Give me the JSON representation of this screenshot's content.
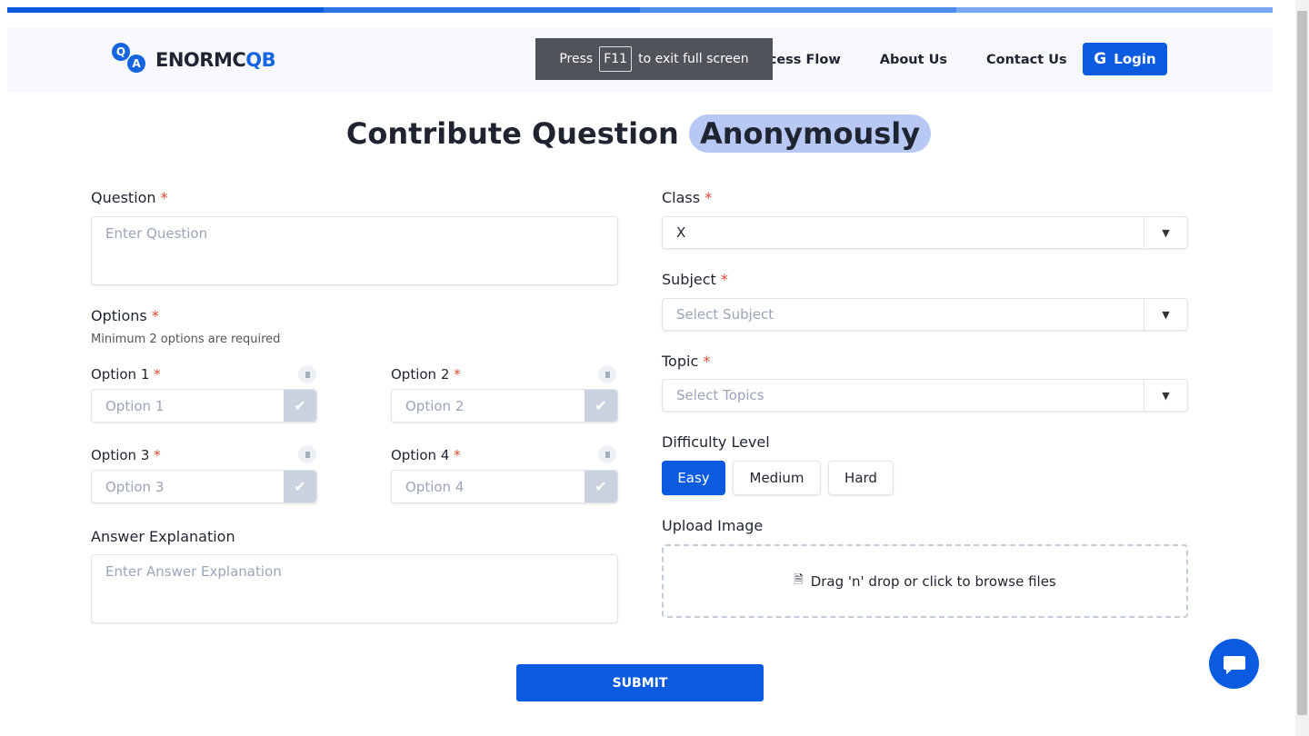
{
  "progress_colors": [
    "#0a5be0",
    "#2c74e8",
    "#4a8cef",
    "#7aa9f3"
  ],
  "brand": {
    "prefix": "ENORMC",
    "suffix": "QB",
    "q": "Q",
    "a": "A"
  },
  "nav": {
    "links": [
      "Process Flow",
      "About Us",
      "Contact Us"
    ],
    "login": "Login"
  },
  "fullscreen_toast": {
    "press": "Press",
    "key": "F11",
    "rest": "to exit full screen"
  },
  "title": {
    "main": "Contribute Question",
    "highlight": "Anonymously"
  },
  "question": {
    "label": "Question",
    "placeholder": "Enter Question"
  },
  "options": {
    "label": "Options",
    "hint": "Minimum 2 options are required",
    "items": [
      {
        "label": "Option 1",
        "placeholder": "Option 1"
      },
      {
        "label": "Option 2",
        "placeholder": "Option 2"
      },
      {
        "label": "Option 3",
        "placeholder": "Option 3"
      },
      {
        "label": "Option 4",
        "placeholder": "Option 4"
      }
    ]
  },
  "explanation": {
    "label": "Answer Explanation",
    "placeholder": "Enter Answer Explanation"
  },
  "class": {
    "label": "Class",
    "value": "X"
  },
  "subject": {
    "label": "Subject",
    "placeholder": "Select Subject"
  },
  "topic": {
    "label": "Topic",
    "placeholder": "Select Topics"
  },
  "difficulty": {
    "label": "Difficulty Level",
    "options": [
      "Easy",
      "Medium",
      "Hard"
    ],
    "selected": "Easy",
    "accent": "#0a5be0"
  },
  "upload": {
    "label": "Upload Image",
    "text": "Drag 'n' drop or click to browse files"
  },
  "submit": "SUBMIT",
  "required_mark": "*"
}
